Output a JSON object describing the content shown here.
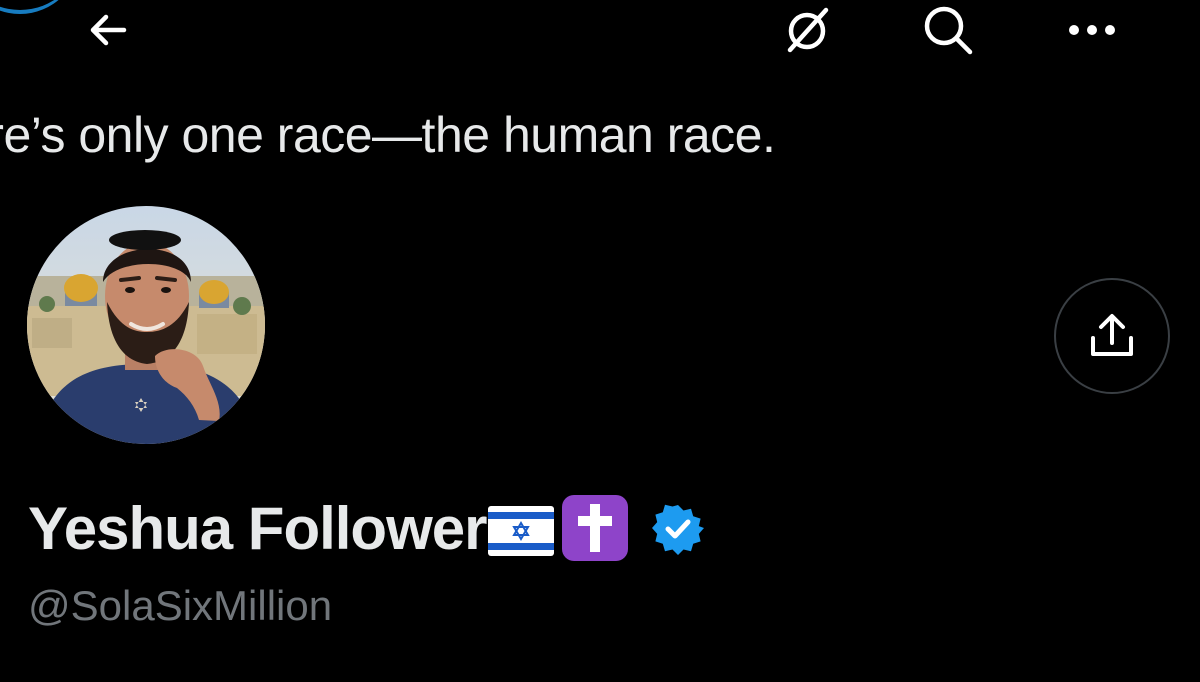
{
  "topbar": {
    "back_icon": "arrow-left-icon",
    "grok_icon": "grok-icon",
    "search_icon": "search-icon",
    "more_icon": "more-horizontal-icon"
  },
  "profile": {
    "bio_fragment": "ere’s only one race—the human race.",
    "display_name": "Yeshua Follower",
    "name_emojis": [
      "israel-flag-emoji",
      "latin-cross-emoji"
    ],
    "verified": true,
    "handle": "@SolaSixMillion",
    "share_icon": "share-icon"
  },
  "colors": {
    "background": "#000000",
    "primary_text": "#e7e9ea",
    "secondary_text": "#71767b",
    "verified_blue": "#1d9bf0",
    "cross_purple": "#8e44c9",
    "button_border": "#3a3f44"
  }
}
